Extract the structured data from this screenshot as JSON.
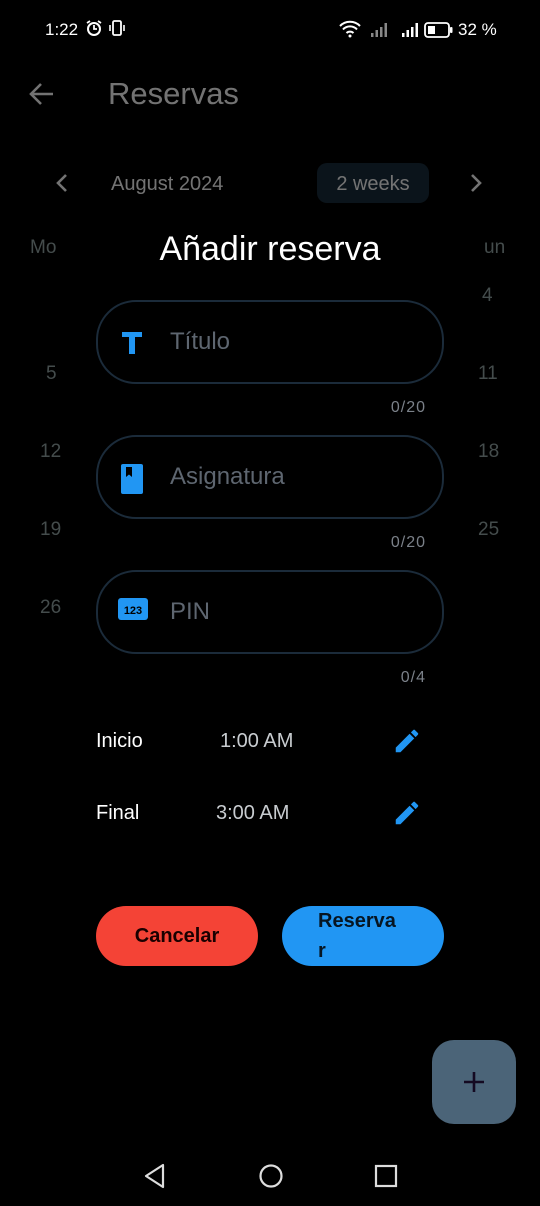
{
  "status_bar": {
    "time": "1:22",
    "battery": "32 %",
    "icons": [
      "alarm-icon",
      "vibrate-icon",
      "wifi-icon",
      "signal-icon",
      "signal-icon",
      "battery-icon"
    ]
  },
  "app_bar": {
    "title": "Reservas",
    "back_icon": "arrow-back-icon"
  },
  "calendar": {
    "month": "August 2024",
    "mode": "2 weeks",
    "weekday_first": "Mo",
    "weekday_last": "un",
    "left_column": [
      "5",
      "12",
      "19",
      "26"
    ],
    "right_column": [
      "4",
      "11",
      "18",
      "25"
    ]
  },
  "dialog": {
    "title": "Añadir reserva",
    "fields": [
      {
        "icon": "title-icon",
        "placeholder": "Título",
        "counter": "0/20"
      },
      {
        "icon": "book-icon",
        "placeholder": "Asignatura",
        "counter": "0/20"
      },
      {
        "icon": "pin-icon",
        "placeholder": "PIN",
        "counter": "0/4"
      }
    ],
    "pin_icon_text": "123",
    "start": {
      "label": "Inicio",
      "value": "1:00 AM"
    },
    "end": {
      "label": "Final",
      "value": "3:00 AM"
    },
    "cancel_label": "Cancelar",
    "reserve_label_line1": "Reserva",
    "reserve_label_line2": "r"
  },
  "colors": {
    "accent": "#2196f3",
    "cancel": "#f44336",
    "fab": "#4b6478"
  }
}
